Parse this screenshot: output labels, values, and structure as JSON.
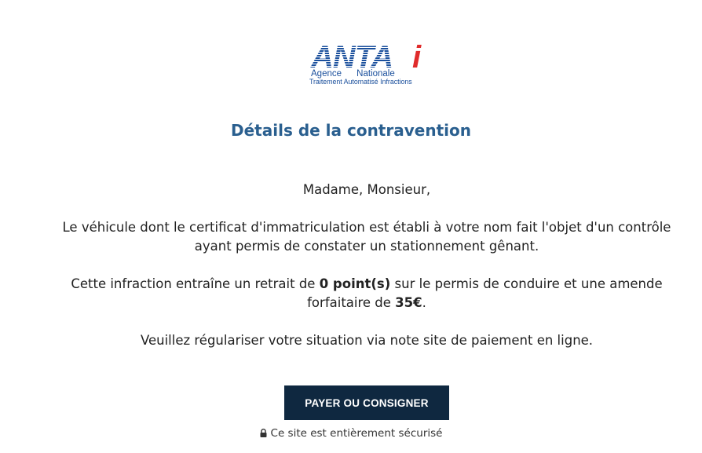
{
  "logo": {
    "wordmark": "ANTAi",
    "line1": "Agence      Nationale",
    "line2": "Traitement Automatisé Infractions",
    "colors": {
      "blue": "#1a4f9c",
      "red": "#e02b2b"
    }
  },
  "page_title": "Détails de la contravention",
  "message": {
    "greeting": "Madame, Monsieur,",
    "vehicle": "Le véhicule dont le certificat d'immatriculation est établi à votre nom fait l'objet d'un contrôle ayant permis de constater un stationnement gênant.",
    "penalty_part1": "Cette infraction entraîne un retrait de ",
    "points": "0 point(s)",
    "penalty_part2": " sur le permis de conduire et une amende forfaitaire de ",
    "amount": "35€",
    "penalty_part3": ".",
    "request": "Veuillez régulariser votre situation via note site de paiement en ligne."
  },
  "actions": {
    "pay_label": "PAYER OU CONSIGNER"
  },
  "security": {
    "icon": "lock-icon",
    "text": "Ce site est entièrement sécurisé"
  },
  "colors": {
    "title": "#2a5f8f",
    "button_bg": "#0f2840",
    "button_text": "#ffffff"
  }
}
